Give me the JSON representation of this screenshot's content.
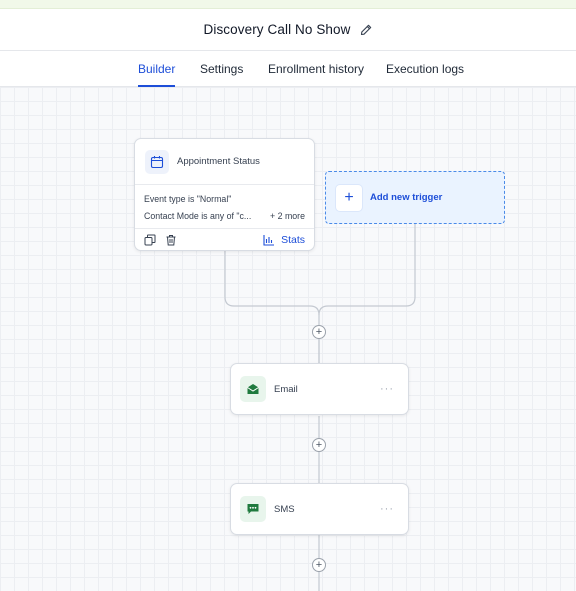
{
  "header": {
    "title": "Discovery Call No Show"
  },
  "tabs": [
    {
      "label": "Builder",
      "active": true
    },
    {
      "label": "Settings",
      "active": false
    },
    {
      "label": "Enrollment history",
      "active": false
    },
    {
      "label": "Execution logs",
      "active": false
    }
  ],
  "trigger": {
    "title": "Appointment Status",
    "conditions": [
      "Event type is \"Normal\"",
      "Contact Mode is any of \"c..."
    ],
    "more": "+ 2 more",
    "stats_label": "Stats",
    "icon": "calendar-icon"
  },
  "add_trigger": {
    "label": "Add new trigger",
    "icon": "plus-icon"
  },
  "actions": [
    {
      "label": "Email",
      "icon": "email-icon"
    },
    {
      "label": "SMS",
      "icon": "sms-icon"
    }
  ],
  "plus_symbol": "+",
  "menu_symbol": "···",
  "colors": {
    "accent": "#1d4ed8",
    "action_icon": "#1f7a3e",
    "trigger_border": "#4a8ae8"
  }
}
